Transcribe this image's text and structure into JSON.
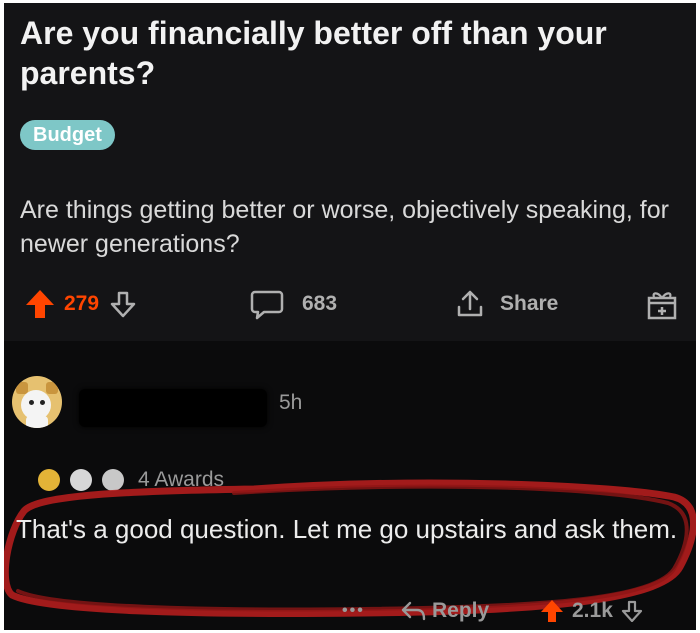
{
  "post": {
    "title": "Are you financially better off than your parents?",
    "flair": "Budget",
    "body": "Are things getting better or worse, objectively speaking, for newer generations?",
    "score": "279",
    "comments_count": "683",
    "share_label": "Share"
  },
  "comment": {
    "time": "5h",
    "awards_label": "4 Awards",
    "text": "That's a good question. Let me go upstairs and ask them.",
    "more_label": "•••",
    "reply_label": "Reply",
    "score": "2.1k"
  },
  "colors": {
    "upvote": "#ff4500",
    "flair_bg": "#7ec7c7",
    "scribble": "#b31d1d"
  }
}
